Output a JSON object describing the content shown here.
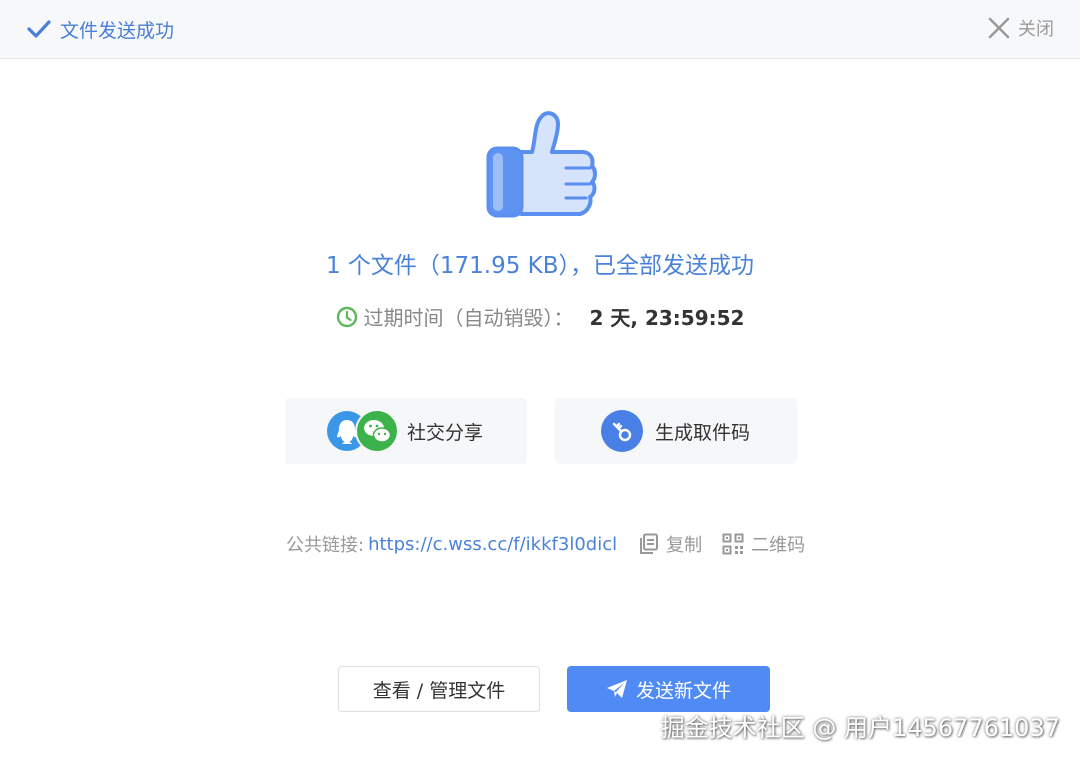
{
  "header": {
    "title": "文件发送成功",
    "close_label": "关闭"
  },
  "result": {
    "message": "1 个文件（171.95 KB），已全部发送成功",
    "expire_label": "过期时间（自动销毁）：",
    "expire_value": "2 天, 23:59:52"
  },
  "actions": {
    "share_label": "社交分享",
    "code_label": "生成取件码"
  },
  "link": {
    "label": "公共链接:",
    "url": "https://c.wss.cc/f/ikkf3l0dicl",
    "copy_label": "复制",
    "qr_label": "二维码"
  },
  "buttons": {
    "manage_label": "查看 / 管理文件",
    "send_label": "发送新文件"
  },
  "watermark": "掘金技术社区 @ 用户14567761037",
  "colors": {
    "accent": "#4a82d8",
    "primary_button": "#4f8af5",
    "qq": "#3a96e6",
    "wechat": "#3cb34a",
    "clock": "#5cb85c"
  },
  "icons": {
    "header": "check-icon",
    "close": "close-icon",
    "hero": "thumbs-up-icon",
    "expire": "clock-icon",
    "share": [
      "qq-icon",
      "wechat-icon"
    ],
    "code": "key-icon",
    "copy": "copy-icon",
    "qr": "qr-code-icon",
    "send": "paper-plane-icon"
  }
}
